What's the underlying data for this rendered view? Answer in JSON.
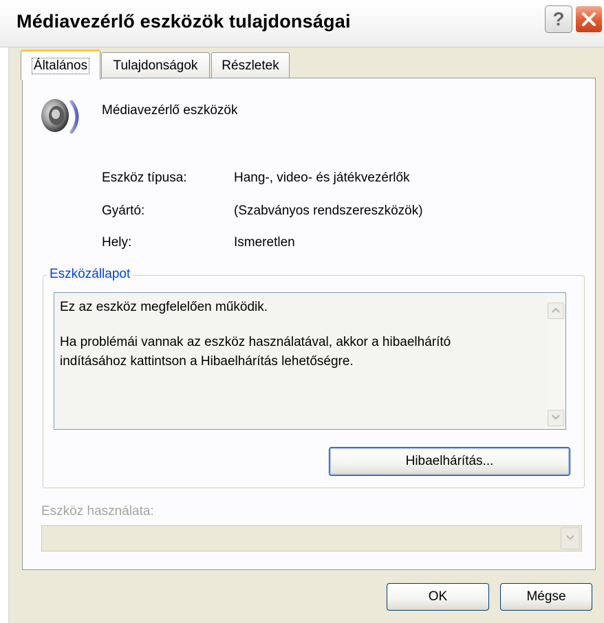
{
  "window": {
    "title": "Médiavezérlő eszközök tulajdonságai",
    "help_label": "?",
    "close_label": "✕"
  },
  "tabs": [
    {
      "label": "Általános",
      "active": true
    },
    {
      "label": "Tulajdonságok",
      "active": false
    },
    {
      "label": "Részletek",
      "active": false
    }
  ],
  "device": {
    "name": "Médiavezérlő eszközök",
    "icon": "speaker-icon"
  },
  "properties": [
    {
      "label": "Eszköz típusa:",
      "value": "Hang-, video- és játékvezérlők"
    },
    {
      "label": "Gyártó:",
      "value": "(Szabványos rendszereszközök)"
    },
    {
      "label": "Hely:",
      "value": "Ismeretlen"
    }
  ],
  "status_group": {
    "title": "Eszközállapot",
    "line1": "Ez az eszköz megfelelően működik.",
    "line2": "Ha problémái vannak az eszköz használatával, akkor a hibaelhárító",
    "line3": "indításához kattintson a Hibaelhárítás lehetőségre.",
    "troubleshoot_button": "Hibaelhárítás..."
  },
  "usage": {
    "label": "Eszköz használata:",
    "value": ""
  },
  "buttons": {
    "ok": "OK",
    "cancel": "Mégse"
  },
  "colors": {
    "group_title": "#0046d5",
    "active_tab_accent": "#ffc83c",
    "close_button": "#e25a2f"
  }
}
